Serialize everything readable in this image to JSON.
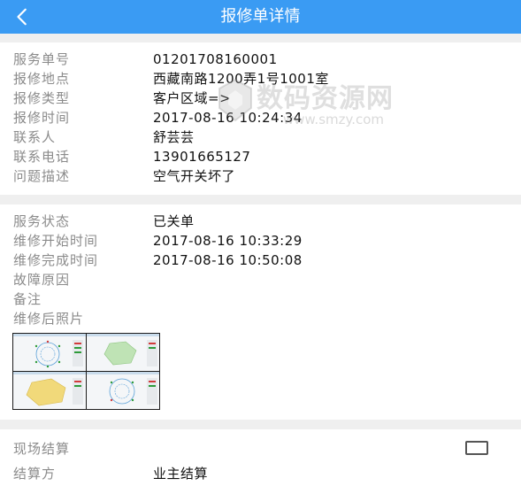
{
  "header": {
    "title": "报修单详情",
    "back_icon": "chevron-left-icon",
    "background": "#3a9bf3"
  },
  "ticket": [
    {
      "label": "服务单号",
      "value": "01201708160001"
    },
    {
      "label": "报修地点",
      "value": "西藏南路1200弄1号1001室"
    },
    {
      "label": "报修类型",
      "value": "客户区域=>"
    },
    {
      "label": "报修时间",
      "value": "2017-08-16 10:24:34"
    },
    {
      "label": "联系人",
      "value": "舒芸芸"
    },
    {
      "label": "联系电话",
      "value": "13901665127"
    },
    {
      "label": "问题描述",
      "value": "空气开关坏了"
    }
  ],
  "service": [
    {
      "label": "服务状态",
      "value": "已关单"
    },
    {
      "label": "维修开始时间",
      "value": "2017-08-16 10:33:29"
    },
    {
      "label": "维修完成时间",
      "value": "2017-08-16 10:50:08"
    },
    {
      "label": "故障原因",
      "value": ""
    },
    {
      "label": "备注",
      "value": ""
    },
    {
      "label": "维修后照片",
      "value": ""
    }
  ],
  "settlement": {
    "onsite_label": "现场结算",
    "onsite_checked": false,
    "party_label": "结算方",
    "party_value": "业主结算"
  },
  "watermark": {
    "text": "数码资源网",
    "url": "www.smzy.com"
  },
  "colors": {
    "label": "#8b8b8b",
    "value": "#111111",
    "divider": "#efefef"
  }
}
